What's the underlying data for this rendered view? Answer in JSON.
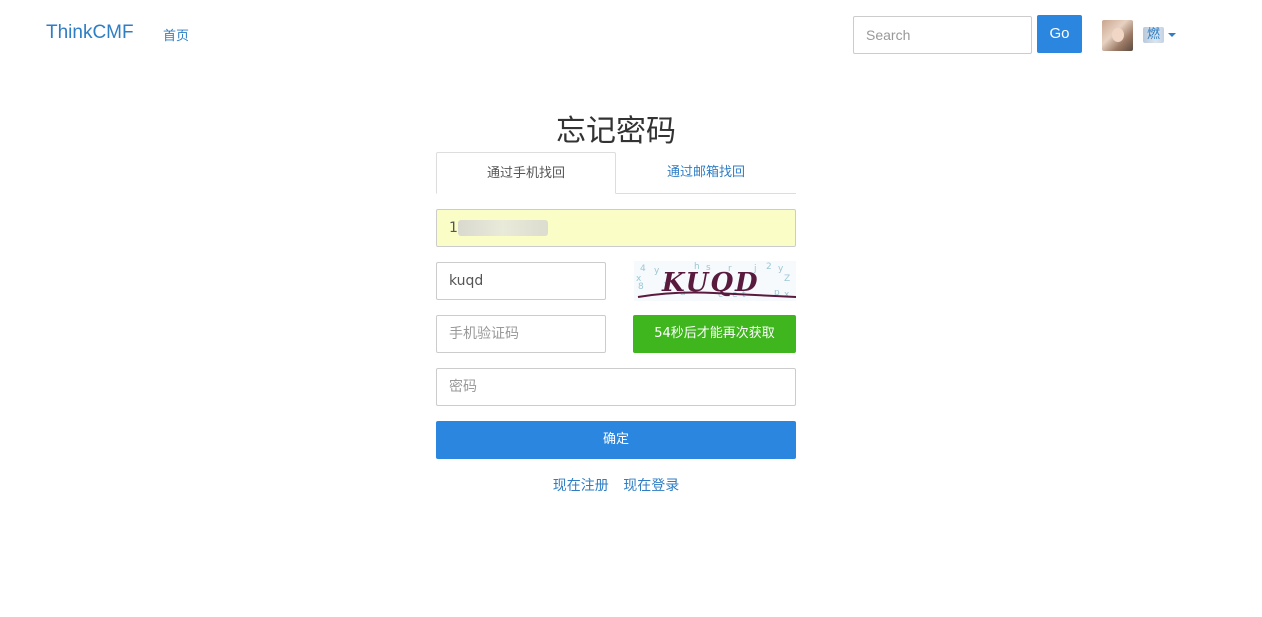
{
  "navbar": {
    "brand": "ThinkCMF",
    "home_link": "首页",
    "search_placeholder": "Search",
    "go_label": "Go",
    "user_name": "燃"
  },
  "form": {
    "title": "忘记密码",
    "tabs": [
      {
        "label": "通过手机找回",
        "active": true
      },
      {
        "label": "通过邮箱找回",
        "active": false
      }
    ],
    "phone_value": "1",
    "captcha_value": "kuqd",
    "captcha_image_text": "KUQD",
    "sms_placeholder": "手机验证码",
    "sms_button_label": "54秒后才能再次获取",
    "password_placeholder": "密码",
    "confirm_label": "确定",
    "links": {
      "register": "现在注册",
      "login": "现在登录"
    }
  },
  "colors": {
    "accent": "#2b86e0",
    "link": "#2f7ec4",
    "success": "#3fb61e",
    "autofill": "#fafdc5"
  }
}
